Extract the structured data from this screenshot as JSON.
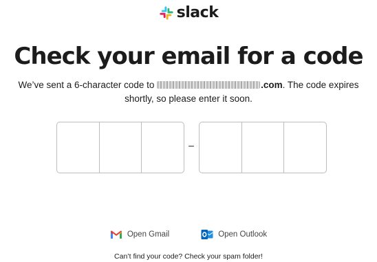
{
  "logo": {
    "wordmark": "slack",
    "icon": "slack-logo-icon",
    "colors": [
      "#36C5F0",
      "#2EB67D",
      "#ECB22E",
      "#E01E5A"
    ]
  },
  "heading": {
    "title": "Check your email for a code",
    "subtitle_before": "We’ve sent a 6-character code to ",
    "email_visible_suffix": ".com",
    "subtitle_after": ". The code expires shortly, so please enter it soon."
  },
  "code_input": {
    "separator": "–",
    "values": [
      "",
      "",
      "",
      "",
      "",
      ""
    ]
  },
  "links": {
    "gmail": {
      "label": "Open Gmail",
      "icon": "gmail-icon"
    },
    "outlook": {
      "label": "Open Outlook",
      "icon": "outlook-icon"
    }
  },
  "footer": {
    "spam_note": "Can’t find your code? Check your spam folder!"
  }
}
